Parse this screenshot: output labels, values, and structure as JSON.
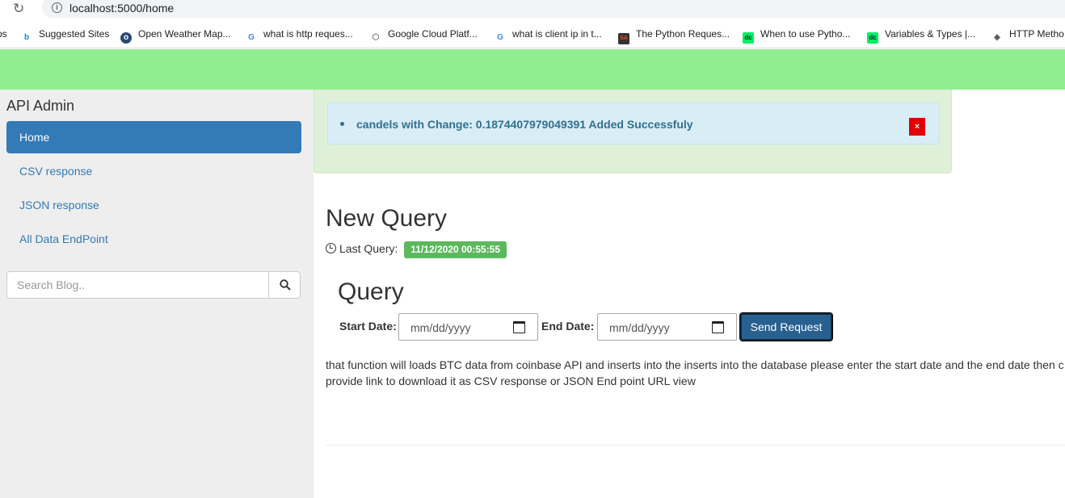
{
  "browser": {
    "url": "localhost:5000/home",
    "bookmarks": [
      {
        "label": "ps",
        "icon": "apps-icon"
      },
      {
        "label": "Suggested Sites",
        "icon": "bing-icon"
      },
      {
        "label": "Open Weather Map...",
        "icon": "openweather-icon"
      },
      {
        "label": "what is http reques...",
        "icon": "google-icon"
      },
      {
        "label": "Google Cloud Platf...",
        "icon": "gcp-icon"
      },
      {
        "label": "what is client ip in t...",
        "icon": "google-icon"
      },
      {
        "label": "The Python Reques...",
        "icon": "sa-icon"
      },
      {
        "label": "When to use Pytho...",
        "icon": "dc-icon"
      },
      {
        "label": "Variables & Types |...",
        "icon": "dc-icon"
      },
      {
        "label": "HTTP Metho",
        "icon": "http-icon"
      }
    ]
  },
  "sidebar": {
    "brand": "API Admin",
    "items": [
      {
        "label": "Home",
        "active": true
      },
      {
        "label": "CSV response"
      },
      {
        "label": "JSON response"
      },
      {
        "label": "All Data EndPoint"
      }
    ],
    "search": {
      "placeholder": "Search Blog.."
    }
  },
  "flash": {
    "message": "candels with Change: 0.1874407979049391 Added Successfuly",
    "close": "×"
  },
  "main": {
    "title": "New Query",
    "last_query_label": "Last Query:",
    "last_query_value": "11/12/2020 00:55:55",
    "query_title": "Query",
    "start_label": "Start Date:",
    "start_placeholder": "mm/dd/yyyy",
    "end_label": "End Date:",
    "end_placeholder": "mm/dd/yyyy",
    "send_label": "Send Request",
    "description_line1": "that function will loads BTC data from coinbase API and inserts into the inserts into the database please enter the start date and the end date then c",
    "description_line2": "provide link to download it as CSV response or JSON End point URL view"
  },
  "colors": {
    "topbar": "#90ee90",
    "primary": "#337ab7",
    "success": "#5cb85c",
    "info_bg": "#d9edf7",
    "close_red": "#e00000"
  }
}
